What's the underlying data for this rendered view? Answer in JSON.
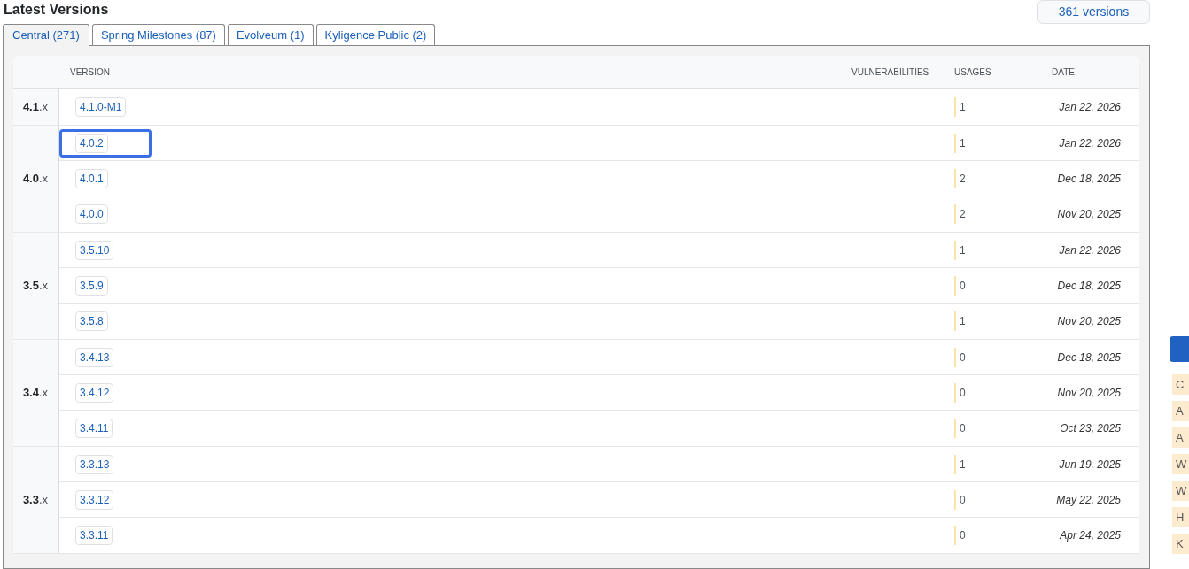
{
  "title": "Latest Versions",
  "versions_button": {
    "label": "361 versions"
  },
  "tabs": [
    {
      "label": "Central (271)",
      "selected": true
    },
    {
      "label": "Spring Milestones (87)",
      "selected": false
    },
    {
      "label": "Evolveum (1)",
      "selected": false
    },
    {
      "label": "Kyligence Public (2)",
      "selected": false
    }
  ],
  "table": {
    "columns": [
      "VERSION",
      "VULNERABILITIES",
      "USAGES",
      "DATE"
    ],
    "groups": [
      {
        "major": "4.1",
        "suffix": ".x",
        "rows": [
          {
            "version": "4.1.0-M1",
            "focused": false,
            "usages": "1",
            "date": "Jan 22, 2026"
          }
        ]
      },
      {
        "major": "4.0",
        "suffix": ".x",
        "rows": [
          {
            "version": "4.0.2",
            "focused": true,
            "usages": "1",
            "date": "Jan 22, 2026"
          },
          {
            "version": "4.0.1",
            "focused": false,
            "usages": "2",
            "date": "Dec 18, 2025"
          },
          {
            "version": "4.0.0",
            "focused": false,
            "usages": "2",
            "date": "Nov 20, 2025"
          }
        ]
      },
      {
        "major": "3.5",
        "suffix": ".x",
        "rows": [
          {
            "version": "3.5.10",
            "focused": false,
            "usages": "1",
            "date": "Jan 22, 2026"
          },
          {
            "version": "3.5.9",
            "focused": false,
            "usages": "0",
            "date": "Dec 18, 2025"
          },
          {
            "version": "3.5.8",
            "focused": false,
            "usages": "1",
            "date": "Nov 20, 2025"
          }
        ]
      },
      {
        "major": "3.4",
        "suffix": ".x",
        "rows": [
          {
            "version": "3.4.13",
            "focused": false,
            "usages": "0",
            "date": "Dec 18, 2025"
          },
          {
            "version": "3.4.12",
            "focused": false,
            "usages": "0",
            "date": "Nov 20, 2025"
          },
          {
            "version": "3.4.11",
            "focused": false,
            "usages": "0",
            "date": "Oct 23, 2025"
          }
        ]
      },
      {
        "major": "3.3",
        "suffix": ".x",
        "rows": [
          {
            "version": "3.3.13",
            "focused": false,
            "usages": "1",
            "date": "Jun 19, 2025"
          },
          {
            "version": "3.3.12",
            "focused": false,
            "usages": "0",
            "date": "May 22, 2025"
          },
          {
            "version": "3.3.11",
            "focused": false,
            "usages": "0",
            "date": "Apr 24, 2025"
          }
        ]
      }
    ]
  },
  "sidebar": {
    "tags": [
      "C",
      "A",
      "A",
      "W",
      "W",
      "H",
      "K"
    ]
  }
}
